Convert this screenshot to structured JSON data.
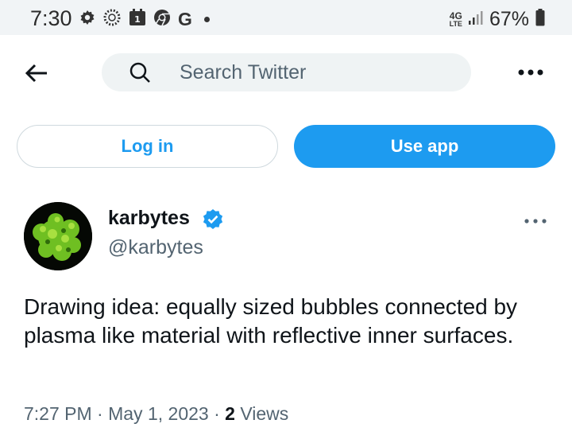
{
  "status_bar": {
    "time": "7:30",
    "notification_icons": [
      "gear-icon",
      "sync-icon",
      "calendar-icon",
      "chrome-icon",
      "google-g-icon",
      "dot-icon"
    ],
    "calendar_day": "1",
    "google_letter": "G",
    "network_top": "4G",
    "network_bottom": "LTE",
    "battery": "67%"
  },
  "header": {
    "search_placeholder": "Search Twitter"
  },
  "auth": {
    "login_label": "Log in",
    "use_app_label": "Use app",
    "accent_color": "#1d9bf0"
  },
  "tweet": {
    "author_name": "karbytes",
    "handle": "@karbytes",
    "verified": true,
    "text": "Drawing idea: equally sized bubbles connected by plasma like material with reflective inner surfaces.",
    "time": "7:27 PM",
    "separator": "·",
    "date": "May 1, 2023",
    "views_count": "2",
    "views_label": "Views"
  }
}
